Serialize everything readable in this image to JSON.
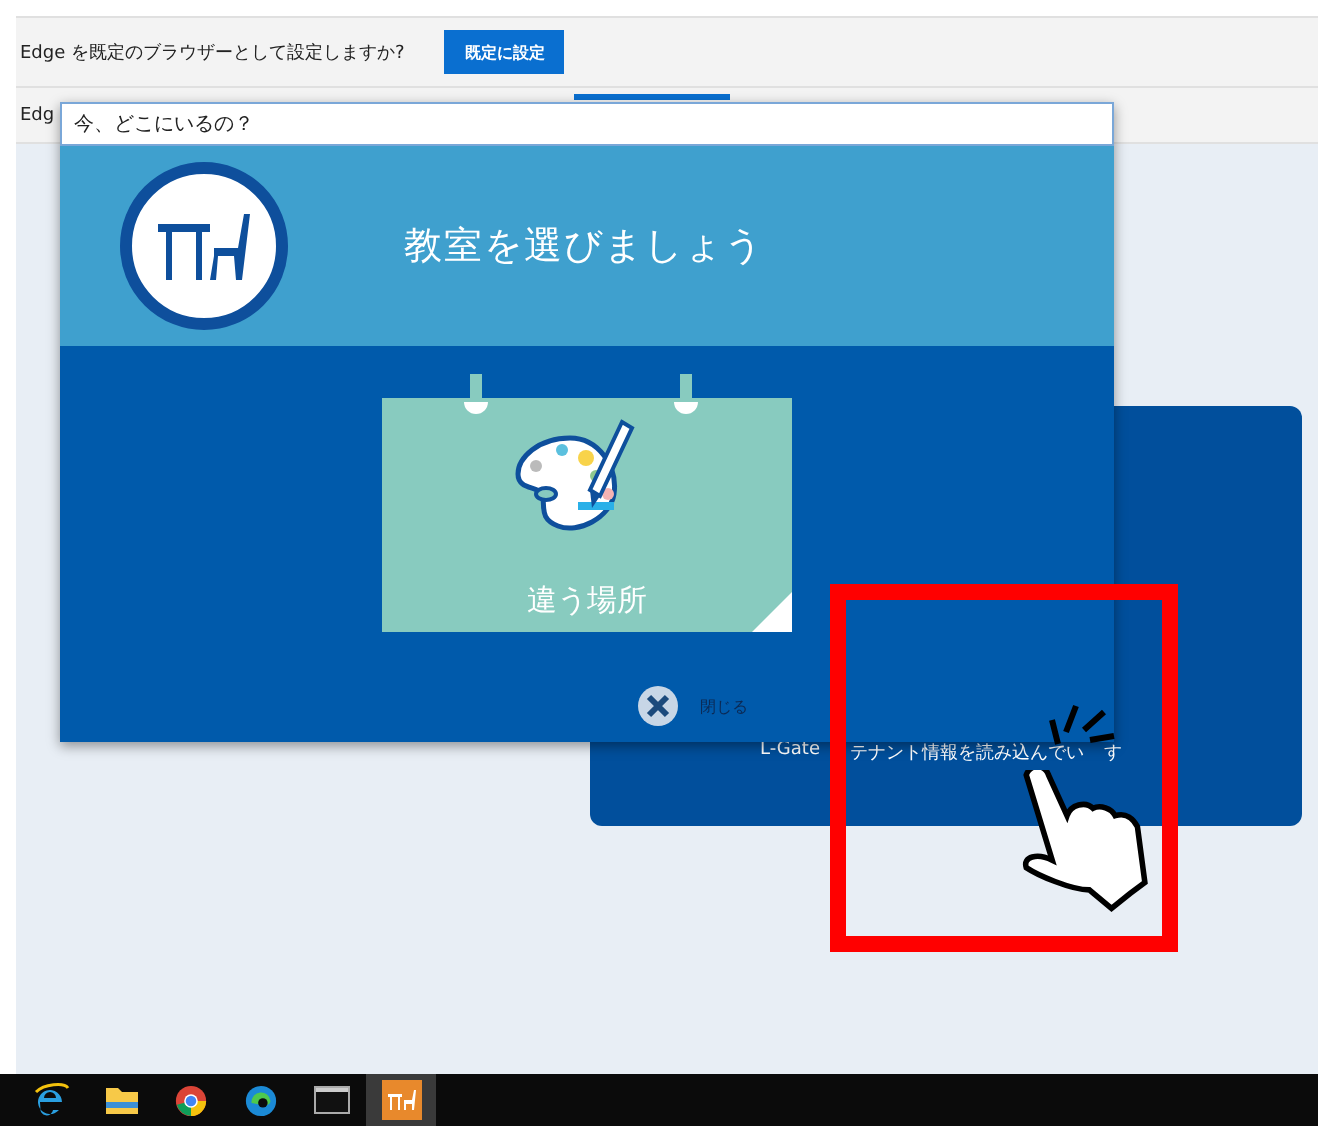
{
  "browser_infobar": {
    "message": "Edge を既定のブラウザーとして設定しますか?",
    "button": "既定に設定"
  },
  "second_infobar": {
    "message": "Edg"
  },
  "background_panel": {
    "status": [
      "L-Gate",
      "テナント情報を読み込んでい",
      "す"
    ]
  },
  "dialog": {
    "title": "今、どこにいるの？",
    "heading": "教室を選びましょう",
    "options": [
      {
        "label": "違う場所"
      }
    ],
    "close_button": "閉じる"
  },
  "taskbar": {
    "apps": [
      {
        "kind": "ie",
        "selected": false
      },
      {
        "kind": "folder",
        "selected": false
      },
      {
        "kind": "chrome",
        "selected": false
      },
      {
        "kind": "edge",
        "selected": false
      },
      {
        "kind": "terminal",
        "selected": false
      },
      {
        "kind": "classroom",
        "selected": true
      }
    ]
  }
}
